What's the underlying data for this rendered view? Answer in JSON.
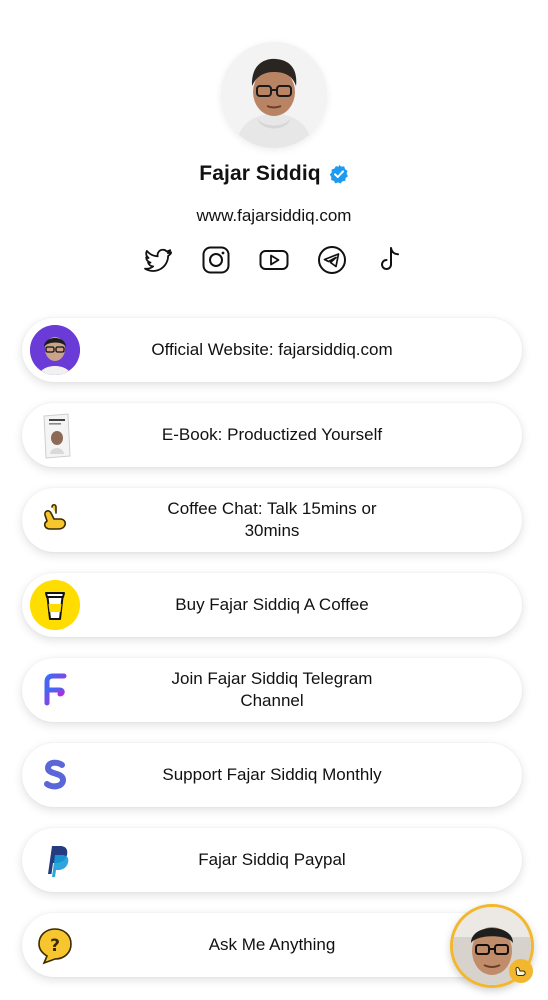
{
  "profile": {
    "name": "Fajar Siddiq",
    "website": "www.fajarsiddiq.com",
    "socials": [
      {
        "icon": "twitter-icon"
      },
      {
        "icon": "instagram-icon"
      },
      {
        "icon": "youtube-icon"
      },
      {
        "icon": "telegram-icon"
      },
      {
        "icon": "tiktok-icon"
      }
    ]
  },
  "links": [
    {
      "label": "Official Website: fajarsiddiq.com",
      "thumb": "avatar-purple"
    },
    {
      "label": "E-Book: Productized Yourself",
      "thumb": "ebook-cover"
    },
    {
      "label": "Coffee Chat: Talk 15mins or 30mins",
      "thumb": "call-hand-icon"
    },
    {
      "label": "Buy Fajar Siddiq A Coffee",
      "thumb": "coffee-cup-icon"
    },
    {
      "label": "Join Fajar Siddiq Telegram Channel",
      "thumb": "f-logo-icon"
    },
    {
      "label": "Support Fajar Siddiq Monthly",
      "thumb": "s-logo-icon"
    },
    {
      "label": "Fajar Siddiq Paypal",
      "thumb": "paypal-icon"
    },
    {
      "label": "Ask Me Anything",
      "thumb": "question-icon"
    }
  ],
  "colors": {
    "verified": "#1d9bf0",
    "coffee_yellow": "#ffdd00",
    "accent_orange": "#f2b72d",
    "purple": "#6a3bd6",
    "paypal_dark": "#253b80",
    "paypal_light": "#179bd7"
  }
}
